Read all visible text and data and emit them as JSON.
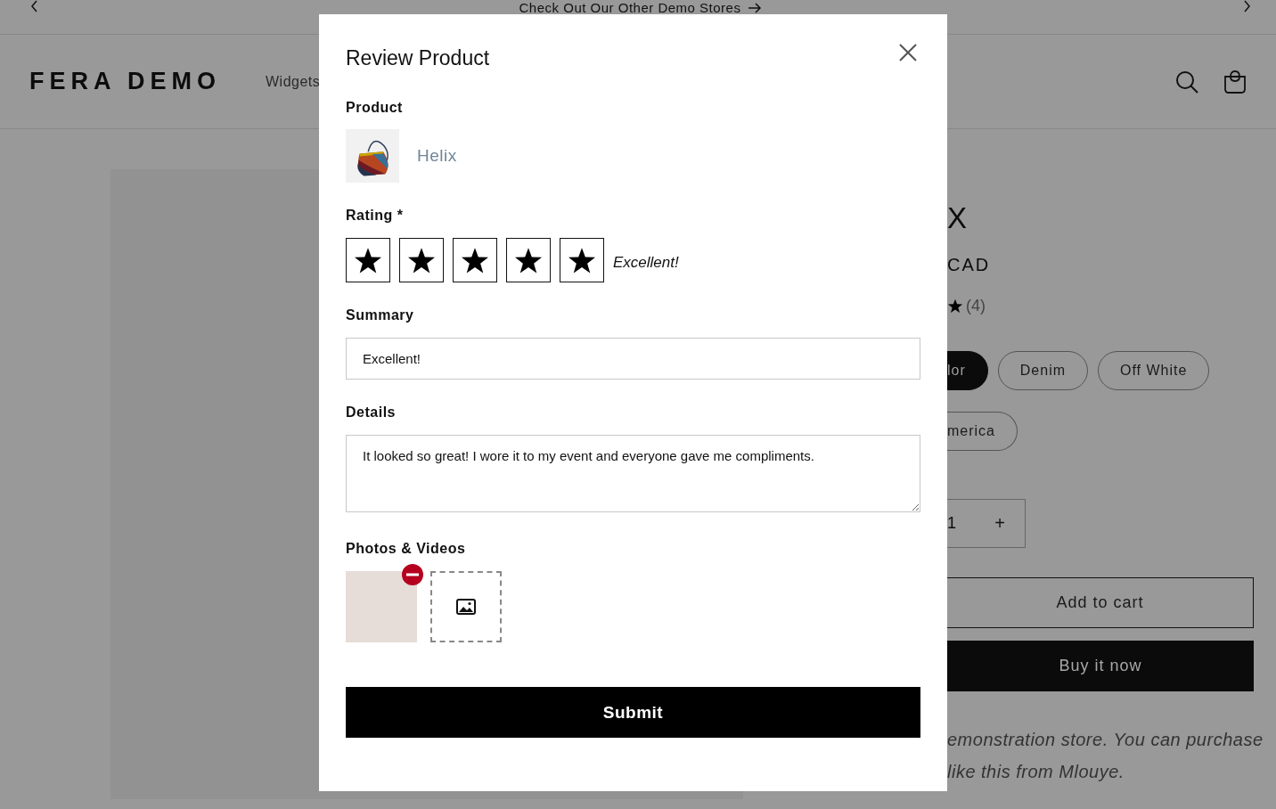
{
  "announcement": {
    "text": "Check Out Our Other Demo Stores"
  },
  "header": {
    "logo": "FERA DEMO",
    "nav": [
      "Widgets"
    ]
  },
  "product": {
    "title": "X",
    "price": "CAD",
    "review_count": "(4)",
    "variants": [
      {
        "label": "lor",
        "selected": true
      },
      {
        "label": "Denim",
        "selected": false
      },
      {
        "label": "Off White",
        "selected": false
      },
      {
        "label": "merica",
        "selected": false
      }
    ],
    "quantity": "1",
    "increment": "+",
    "add_to_cart": "Add to cart",
    "buy_now": "Buy it now",
    "description": [
      "emonstration store. You can purchase",
      "like this from Mlouye."
    ]
  },
  "modal": {
    "title": "Review Product",
    "product_label": "Product",
    "product_name": "Helix",
    "rating_label": "Rating *",
    "stars": 5,
    "rating_text": "Excellent!",
    "summary_label": "Summary",
    "summary_value": "Excellent!",
    "details_label": "Details",
    "details_value": "It looked so great! I wore it to my event and everyone gave me compliments.",
    "media_label": "Photos & Videos",
    "submit": "Submit"
  }
}
